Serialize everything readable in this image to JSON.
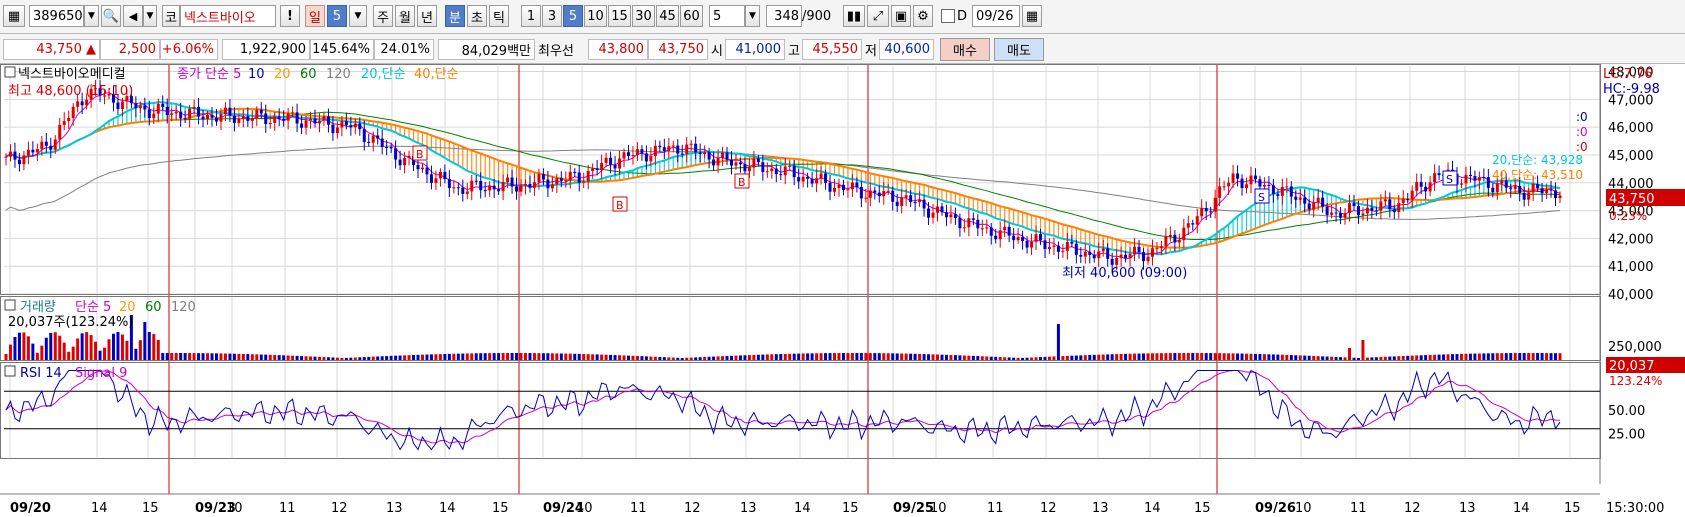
{
  "toolbar": {
    "code": "389650",
    "market_badge": "코",
    "stock_name": "넥스트바이오",
    "excl": "!",
    "period_day": "일",
    "period_num": "5",
    "period_week": "주",
    "period_month": "월",
    "period_year": "년",
    "period_min": "분",
    "period_sec": "초",
    "period_tick": "틱",
    "intervals": [
      "1",
      "3",
      "5",
      "10",
      "15",
      "30",
      "45",
      "60"
    ],
    "interval_active": "5",
    "count_select": "5",
    "count_value": "348",
    "count_total": "/900",
    "date_checkbox_label": "D",
    "date_value": "09/26"
  },
  "infobar": {
    "price": "43,750",
    "change": "2,500",
    "change_pct": "+6.06%",
    "volume": "1,922,900",
    "vol_ratio": "145.64%",
    "turnover": "24.01%",
    "amount": "84,029백만",
    "best_quote_label": "최우선",
    "ask": "43,800",
    "bid": "43,750",
    "open_label": "시",
    "open": "41,000",
    "high_label": "고",
    "high": "45,550",
    "low_label": "저",
    "low": "40,600",
    "buy_label": "매수",
    "sell_label": "매도"
  },
  "colors": {
    "up": "#e00000",
    "down": "#0000c0",
    "ma5": "#cc00cc",
    "ma10": "#0000c0",
    "ma20": "#00c8d8",
    "ma40": "#ff7f00",
    "ma60": "#008000",
    "ma120": "#808080",
    "session_line": "#d00000",
    "grid": "#d8d8d8"
  },
  "chart_data": [
    {
      "type": "candlestick",
      "panel": "price",
      "title": "넥스트바이오메디컬",
      "legend": [
        "종가 단순 5",
        "10",
        "20",
        "60",
        "120",
        "20,단순",
        "40,단순"
      ],
      "y_ticks": [
        "40,000",
        "41,000",
        "42,000",
        "43,000",
        "44,000",
        "45,000",
        "46,000",
        "47,000",
        "48,000"
      ],
      "ylim": [
        40000,
        48200
      ],
      "x_ticks": [
        "09/20",
        "14",
        "15",
        "09/23",
        "10",
        "11",
        "12",
        "13",
        "14",
        "15",
        "09/24",
        "10",
        "11",
        "12",
        "13",
        "14",
        "15",
        "09/25",
        "10",
        "11",
        "12",
        "13",
        "14",
        "15",
        "09/26",
        "10",
        "11",
        "12",
        "13",
        "14",
        "15"
      ],
      "x_time_label": "15:30:00",
      "high_annotation": "최고 48,600 (15:10)",
      "low_annotation": "최저 40,600 (09:00)",
      "lc_label": "LC:7.76",
      "hc_label": "HC:-9.98",
      "ma20_label": "20,단순: 43,928",
      "ma40_label": "40,단순: 43,510",
      "zero_labels": [
        ":0",
        ":0",
        ":0"
      ],
      "last_price_tag": "43,750",
      "last_pct_tag": "0.23%",
      "signal_markers": [
        "B",
        "B",
        "B",
        "S",
        "S"
      ]
    },
    {
      "type": "bar",
      "panel": "volume",
      "title": "거래량",
      "legend": [
        "단순 5",
        "20",
        "60",
        "120"
      ],
      "value_text": "20,037주(123.24%)",
      "y_ticks": [
        "250,000"
      ],
      "last_volume_tag": "20,037",
      "last_volume_pct_tag": "123.24%"
    },
    {
      "type": "line",
      "panel": "rsi",
      "legend": [
        "RSI 14",
        "Signal 9"
      ],
      "y_ticks": [
        "50.00",
        "25.00"
      ],
      "ylim": [
        0,
        100
      ],
      "bands": [
        70,
        30
      ]
    }
  ]
}
